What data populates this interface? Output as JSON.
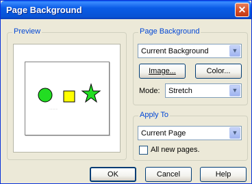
{
  "window": {
    "title": "Page Background",
    "close_glyph": "✕"
  },
  "preview": {
    "legend": "Preview",
    "caption": "··········"
  },
  "background": {
    "legend": "Page Background",
    "source_value": "Current Background",
    "image_button": "Image...",
    "color_button": "Color...",
    "mode_label": "Mode:",
    "mode_value": "Stretch"
  },
  "apply": {
    "legend": "Apply To",
    "target_value": "Current Page",
    "all_pages_label": "All new pages.",
    "all_pages_checked": false
  },
  "buttons": {
    "ok": "OK",
    "cancel": "Cancel",
    "help": "Help"
  },
  "colors": {
    "circle": "#22dd22",
    "square": "#ffff00",
    "star": "#22dd22",
    "accent": "#0046d5"
  }
}
